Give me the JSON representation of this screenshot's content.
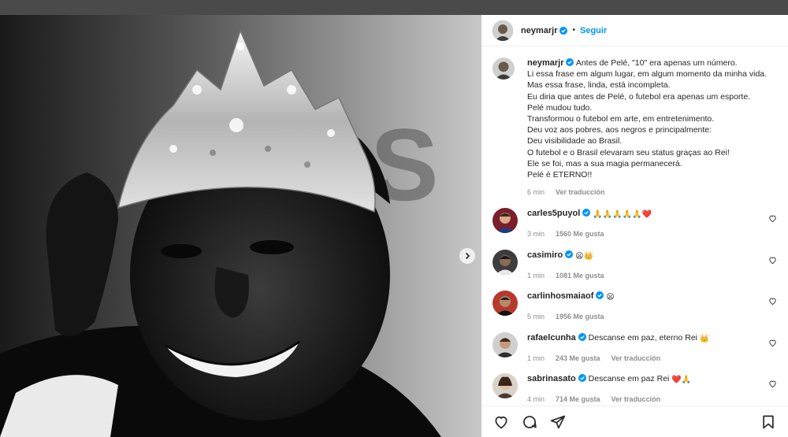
{
  "post": {
    "author": "neymarjr",
    "follow_label": "Seguir",
    "dot": "•",
    "more": "•••"
  },
  "caption": {
    "author": "neymarjr",
    "lines": [
      "Antes de Pelé, \"10\" era apenas um número.",
      "Li essa frase em algum lugar, em algum momento da minha vida.",
      "Mas essa frase, linda, está incompleta.",
      "Eu diria que antes de Pelé, o futebol era apenas um esporte.",
      "Pelé mudou tudo.",
      "Transformou o futebol em arte, em entretenimento.",
      "Deu voz aos pobres, aos negros e principalmente:",
      "Deu visibilidade ao Brasil.",
      "O futebol e o Brasil elevaram seu status graças ao Rei!",
      "Ele se foi, mas a sua magia permanecerá.",
      "Pelé é ETERNO!!"
    ],
    "time": "6 min",
    "translate": "Ver traducción"
  },
  "comments": [
    {
      "user": "carles5puyol",
      "text": "",
      "emoji": "🙏🙏🙏🙏🙏❤️",
      "time": "3 min",
      "likes": "1560 Me gusta",
      "translate": ""
    },
    {
      "user": "casimiro",
      "text": "",
      "emoji": "😦👑",
      "time": "1 min",
      "likes": "1081 Me gusta",
      "translate": ""
    },
    {
      "user": "carlinhosmaiaof",
      "text": "",
      "emoji": "😦",
      "time": "5 min",
      "likes": "1956 Me gusta",
      "translate": ""
    },
    {
      "user": "rafaelcunha",
      "text": "Descanse em paz, eterno Rei",
      "emoji": "👑",
      "time": "1 min",
      "likes": "243 Me gusta",
      "translate": "Ver traducción"
    },
    {
      "user": "sabrinasato",
      "text": "Descanse em paz Rei",
      "emoji": "❤️🙏",
      "time": "4 min",
      "likes": "714 Me gusta",
      "translate": "Ver traducción"
    }
  ],
  "colors": {
    "accent": "#0095f6",
    "verified": "#0095f6",
    "secondary_text": "#8e8e8e"
  },
  "icons": {
    "like": "heart-icon",
    "comment": "comment-icon",
    "share": "share-icon",
    "save": "bookmark-icon",
    "next": "chevron-right-icon"
  }
}
